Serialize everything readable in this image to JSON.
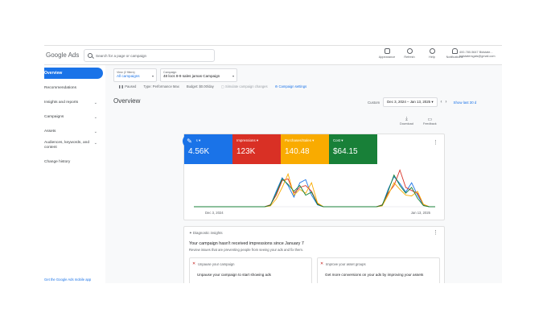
{
  "app": {
    "title": "Google Ads"
  },
  "search": {
    "placeholder": "Search for a page or campaign"
  },
  "toolbar": {
    "items": [
      {
        "label": "Appearance",
        "icon": "appearance-icon"
      },
      {
        "label": "Refresh",
        "icon": "refresh-icon"
      },
      {
        "label": "Help",
        "icon": "help-icon"
      },
      {
        "label": "Notifications",
        "icon": "bell-icon"
      }
    ],
    "account_line1": "400-780-5647 Bidstate...",
    "account_line2": "bidstatersgals@gmail.com"
  },
  "sidebar": {
    "active": "Overview",
    "items": [
      {
        "label": "Recommendations",
        "chevron": false
      },
      {
        "label": "Insights and reports",
        "chevron": true
      },
      {
        "label": "Campaigns",
        "chevron": true
      },
      {
        "label": "Assets",
        "chevron": true
      },
      {
        "label": "Audiences, keywords, and content",
        "chevron": true
      },
      {
        "label": "Change history",
        "chevron": false
      }
    ],
    "mobile_link": "Get the Google Ads mobile app"
  },
  "selectors": {
    "view_title": "View (2 filters)",
    "view_value": "All campaigns",
    "campaign_title": "Campaign",
    "campaign_value": "48 locs 8-9 sales jamas Campaign"
  },
  "status": {
    "paused": "Paused",
    "type": "Type: Performance Max",
    "budget": "Budget: $0.00/day",
    "simulate": "Simulate campaign changes",
    "settings": "Campaign settings"
  },
  "overview": {
    "title": "Overview",
    "custom_label": "Custom",
    "date_range": "Dec 3, 2024 – Jan 13, 2025",
    "show_last": "Show last 30 d",
    "download": "Download",
    "feedback": "Feedback"
  },
  "metrics": [
    {
      "label": "Clicks",
      "value": "4.56K",
      "color": "#1a73e8"
    },
    {
      "label": "Impressions",
      "value": "123K",
      "color": "#d93025"
    },
    {
      "label": "Purchases/Sales",
      "value": "140.48",
      "color": "#f9ab00"
    },
    {
      "label": "Cost",
      "value": "$64.15",
      "color": "#188038"
    }
  ],
  "chart_data": {
    "type": "line",
    "x_start": "Dec 3, 2024",
    "x_end": "Jan 13, 2025",
    "ylim": [
      0,
      100
    ],
    "series": [
      {
        "name": "Clicks",
        "color": "#1a73e8",
        "values": [
          0,
          0,
          0,
          0,
          0,
          0,
          0,
          0,
          0,
          0,
          0,
          0,
          0,
          3,
          40,
          75,
          55,
          25,
          62,
          70,
          30,
          5,
          0,
          0,
          0,
          0,
          0,
          0,
          0,
          0,
          0,
          0,
          3,
          45,
          78,
          60,
          38,
          62,
          30,
          4,
          0,
          0
        ]
      },
      {
        "name": "Impressions",
        "color": "#d93025",
        "values": [
          0,
          0,
          0,
          0,
          0,
          0,
          0,
          0,
          0,
          0,
          0,
          0,
          0,
          5,
          30,
          68,
          72,
          35,
          50,
          55,
          40,
          8,
          0,
          0,
          0,
          0,
          0,
          0,
          0,
          0,
          0,
          0,
          5,
          35,
          55,
          95,
          50,
          42,
          35,
          6,
          0,
          0
        ]
      },
      {
        "name": "Purchases/Sales",
        "color": "#f9ab00",
        "values": [
          0,
          0,
          0,
          0,
          0,
          0,
          0,
          0,
          0,
          0,
          0,
          0,
          0,
          2,
          20,
          50,
          85,
          30,
          45,
          35,
          62,
          10,
          0,
          0,
          0,
          0,
          0,
          0,
          0,
          0,
          0,
          0,
          2,
          30,
          62,
          45,
          30,
          28,
          40,
          6,
          0,
          0
        ]
      },
      {
        "name": "Cost",
        "color": "#188038",
        "values": [
          0,
          0,
          0,
          0,
          0,
          0,
          0,
          0,
          0,
          0,
          0,
          0,
          0,
          4,
          35,
          72,
          58,
          40,
          55,
          30,
          38,
          6,
          0,
          0,
          0,
          0,
          0,
          0,
          0,
          0,
          0,
          0,
          4,
          40,
          82,
          55,
          35,
          50,
          22,
          3,
          0,
          0
        ]
      }
    ]
  },
  "insights": {
    "tag": "Diagnostic insights",
    "title": "Your campaign hasn't received impressions since January 7",
    "subtitle": "Review issues that are preventing people from seeing your ads and fix them.",
    "cards": [
      {
        "heading": "Unpause your campaign",
        "body": "Unpause your campaign to start showing ads"
      },
      {
        "heading": "Improve your asset groups",
        "body": "Get more conversions on your ads by improving your assets"
      }
    ]
  }
}
